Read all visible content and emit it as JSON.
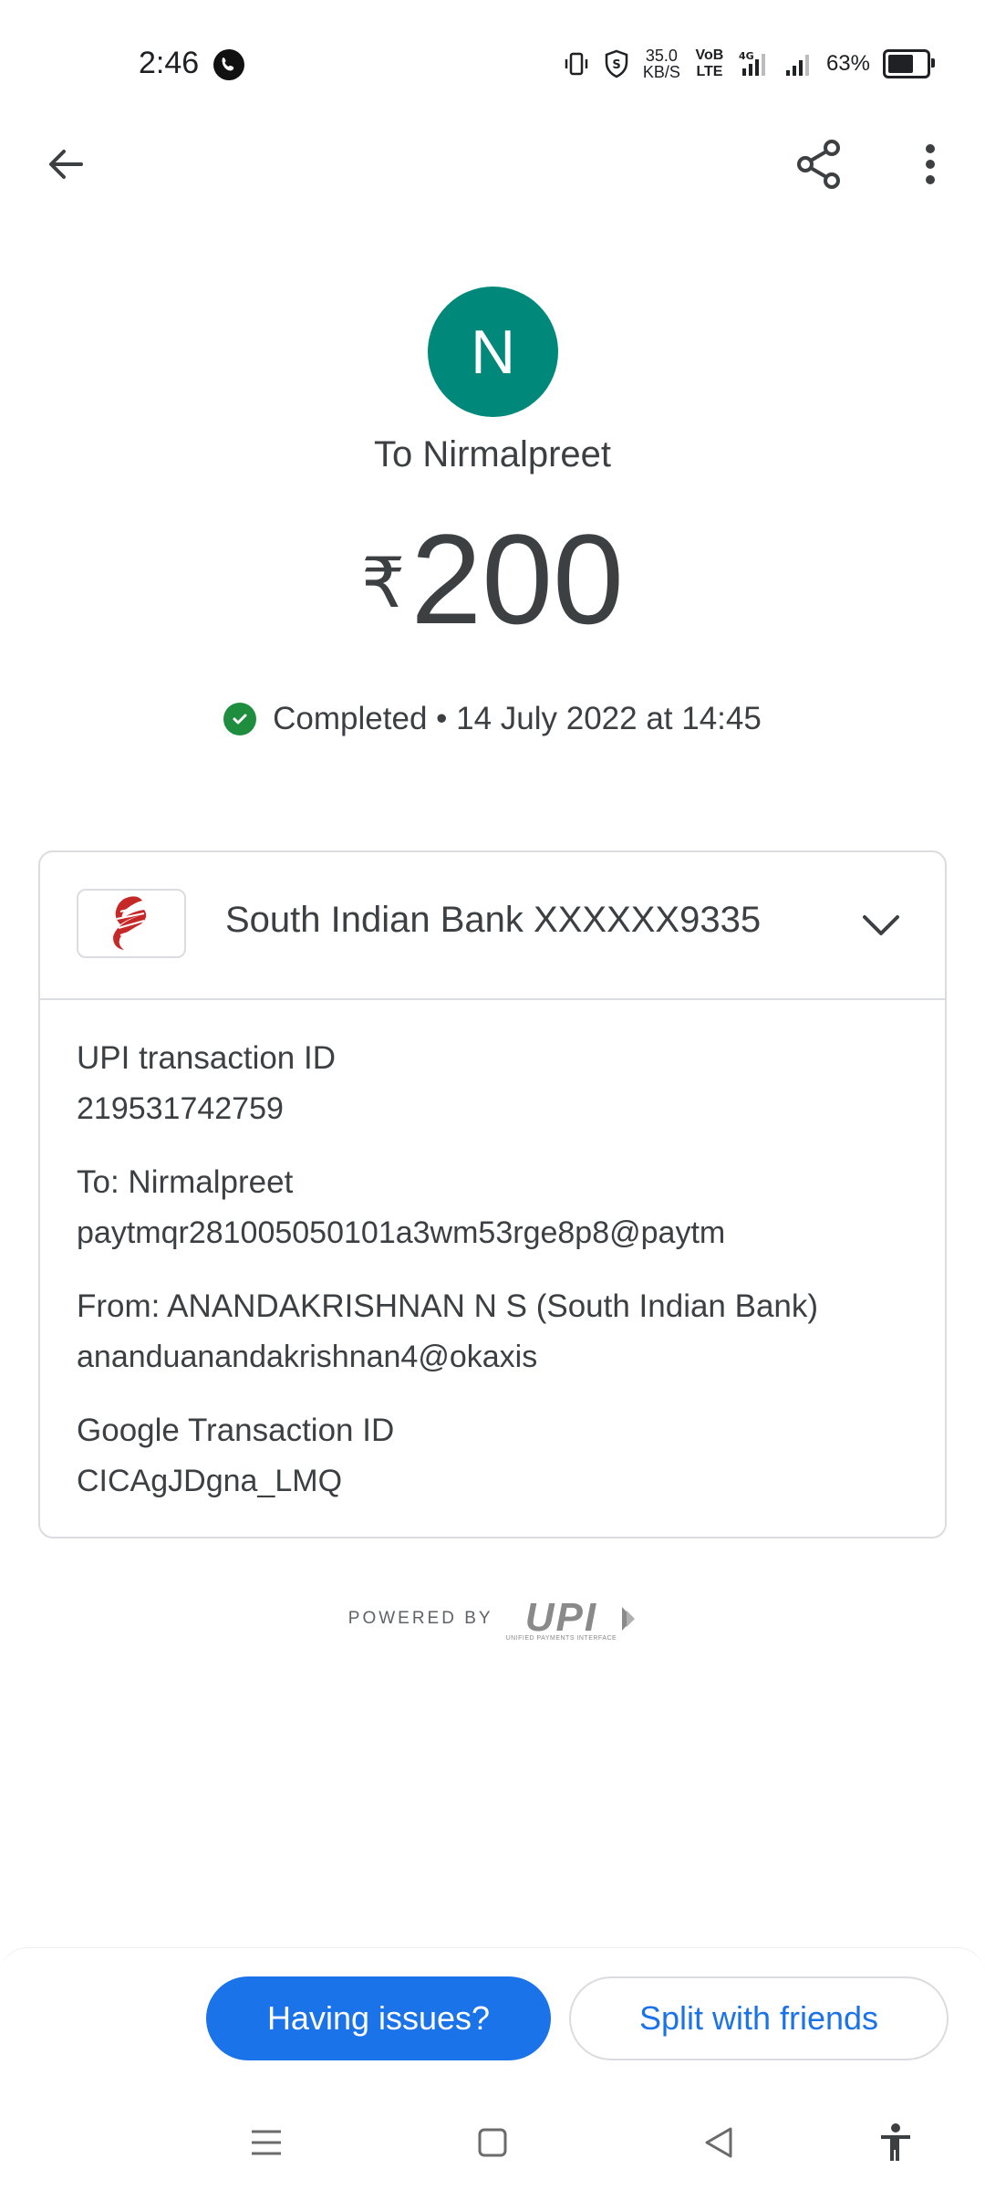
{
  "status_bar": {
    "time": "2:46",
    "speed_value": "35.0",
    "speed_unit": "KB/S",
    "volte": "VoB LTE",
    "network": "4G",
    "battery": "63%",
    "battery_level": 0.63
  },
  "transaction": {
    "avatar_letter": "N",
    "avatar_color": "#00897b",
    "to_label": "To Nirmalpreet",
    "currency": "₹",
    "amount": "200",
    "status": "Completed • 14 July 2022 at 14:45"
  },
  "bank": {
    "name": "South Indian Bank XXXXXX9335"
  },
  "details": [
    {
      "label": "UPI transaction ID",
      "value": "219531742759"
    },
    {
      "label": "To: Nirmalpreet",
      "value": "paytmqr281005050101a3wm53rge8p8@paytm"
    },
    {
      "label": "From: ANANDAKRISHNAN N S (South Indian Bank)",
      "value": "ananduanandakrishnan4@okaxis"
    },
    {
      "label": "Google Transaction ID",
      "value": "CICAgJDgna_LMQ"
    }
  ],
  "footer": {
    "powered_by": "POWERED BY",
    "upi": "UPI",
    "upi_sub": "UNIFIED PAYMENTS INTERFACE"
  },
  "actions": {
    "issues": "Having issues?",
    "split": "Split with friends"
  },
  "colors": {
    "primary": "#1a73e8",
    "success": "#1e8e3e",
    "text": "#3c4043"
  }
}
